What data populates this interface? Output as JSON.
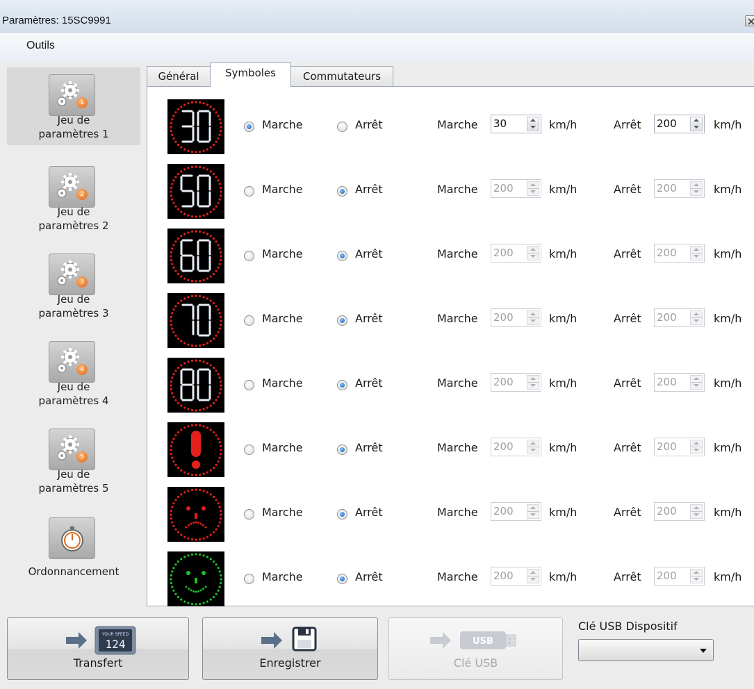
{
  "window": {
    "title": "Paramètres: 15SC9991"
  },
  "menu": {
    "tools": "Outils"
  },
  "sidebar": {
    "items": [
      {
        "line1": "Jeu de",
        "line2": "paramètres 1",
        "badge": "1",
        "icon": "gears-icon"
      },
      {
        "line1": "Jeu de",
        "line2": "paramètres 2",
        "badge": "2",
        "icon": "gears-icon"
      },
      {
        "line1": "Jeu de",
        "line2": "paramètres 3",
        "badge": "3",
        "icon": "gears-icon"
      },
      {
        "line1": "Jeu de",
        "line2": "paramètres 4",
        "badge": "4",
        "icon": "gears-icon"
      },
      {
        "line1": "Jeu de",
        "line2": "paramètres 5",
        "badge": "5",
        "icon": "gears-icon"
      },
      {
        "line1": "Ordonnancement",
        "line2": "",
        "icon": "stopwatch-icon"
      }
    ]
  },
  "tabs": [
    "Général",
    "Symboles",
    "Commutateurs"
  ],
  "labels": {
    "on": "Marche",
    "off": "Arrêt",
    "unit": "km/h"
  },
  "symbols": [
    {
      "kind": "speed-30",
      "text": "30",
      "selected": "Marche",
      "on_value": "30",
      "off_value": "200",
      "enabled": true
    },
    {
      "kind": "speed-50",
      "text": "50",
      "selected": "Arrêt",
      "on_value": "200",
      "off_value": "200",
      "enabled": false
    },
    {
      "kind": "speed-60",
      "text": "60",
      "selected": "Arrêt",
      "on_value": "200",
      "off_value": "200",
      "enabled": false
    },
    {
      "kind": "speed-70",
      "text": "70",
      "selected": "Arrêt",
      "on_value": "200",
      "off_value": "200",
      "enabled": false
    },
    {
      "kind": "speed-80",
      "text": "80",
      "selected": "Arrêt",
      "on_value": "200",
      "off_value": "200",
      "enabled": false
    },
    {
      "kind": "warning",
      "text": "",
      "selected": "Arrêt",
      "on_value": "200",
      "off_value": "200",
      "enabled": false
    },
    {
      "kind": "sad-face",
      "text": "",
      "selected": "Arrêt",
      "on_value": "200",
      "off_value": "200",
      "enabled": false
    },
    {
      "kind": "happy-face",
      "text": "",
      "selected": "Arrêt",
      "on_value": "200",
      "off_value": "200",
      "enabled": false
    }
  ],
  "colors": {
    "led_red": "#e3201b",
    "led_green": "#1fc12b"
  },
  "buttons": {
    "transfer": "Transfert",
    "transfer_display_top": "YOUR SPEED",
    "transfer_display_value": "124",
    "save": "Enregistrer",
    "usb": "Clé USB",
    "usb_icon_text": "USB"
  },
  "usb_device": {
    "label": "Clé USB Dispositif",
    "selected": ""
  }
}
